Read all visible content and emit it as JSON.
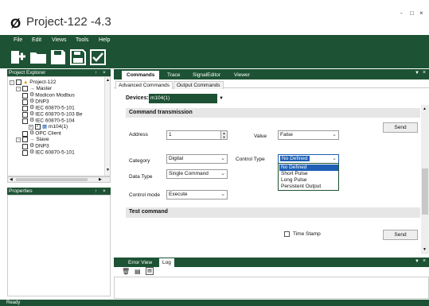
{
  "window": {
    "title": "Project-122 -4.3",
    "minimize": "-",
    "maximize": "□",
    "close": "×"
  },
  "menu": [
    "File",
    "Edit",
    "Views",
    "Tools",
    "Help"
  ],
  "toolbar": {
    "icons": [
      "new-project-icon",
      "open-folder-icon",
      "save-icon",
      "save-all-icon",
      "checklist-icon"
    ]
  },
  "project_explorer": {
    "title": "Project Explorer",
    "pin": "↑",
    "close": "×",
    "tree": [
      {
        "label": "Project-122"
      },
      {
        "label": "Master"
      },
      {
        "label": "Modicon Modbus"
      },
      {
        "label": "DNP3"
      },
      {
        "label": "IEC 60870-5-101"
      },
      {
        "label": "IEC 60870-5-103 Be"
      },
      {
        "label": "IEC 60870-5-104"
      },
      {
        "label": "m104(1)"
      },
      {
        "label": "OPC Client"
      },
      {
        "label": "Slave"
      },
      {
        "label": "DNP3"
      },
      {
        "label": "IEC 60870-5-101"
      }
    ]
  },
  "properties": {
    "title": "Properties",
    "pin": "↑",
    "close": "×"
  },
  "main_tabs": [
    "Commands",
    "Trace",
    "SignalEditor",
    "Viewer"
  ],
  "sub_tabs": [
    "Advanced Commands",
    "Output Commands"
  ],
  "devices": {
    "label": "Devices:",
    "value": "m104(1)"
  },
  "command_transmission": {
    "title": "Command transmission",
    "send1": "Send",
    "address_label": "Address",
    "address_value": "1",
    "value_label": "Value",
    "value_value": "False",
    "category_label": "Category",
    "category_value": "Digital",
    "control_type_label": "Control Type",
    "control_type_value": "No Defined",
    "control_type_options": [
      "No Defined",
      "Short Pulse",
      "Long Pulse",
      "Persistent Output"
    ],
    "data_type_label": "Data Type",
    "data_type_value": "Single Command",
    "control_mode_label": "Control mode",
    "control_mode_value": "Execute"
  },
  "test_command": {
    "title": "Test command",
    "time_stamp": "Time Stamp",
    "send2": "Send"
  },
  "bottom_tabs": [
    "Error View",
    "Log"
  ],
  "status": {
    "text": "Ready"
  }
}
